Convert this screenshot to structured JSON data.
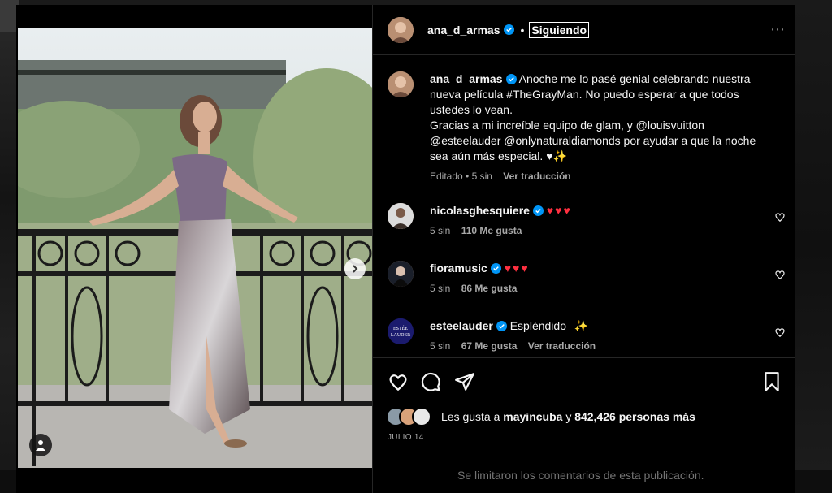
{
  "post": {
    "author": {
      "username": "ana_d_armas",
      "follow_state": "Siguiendo"
    },
    "caption": {
      "text": "Anoche me lo pasé genial celebrando nuestra nueva película #TheGrayMan. No puedo esperar a que todos ustedes lo vean.",
      "text2": "Gracias a mi increíble equipo de glam, y @louisvuitton @esteelauder @onlynaturaldiamonds por ayudar a que la noche sea aún más especial. ♥✨",
      "edited": "Editado • 5 sin",
      "translate": "Ver traducción"
    },
    "comments": [
      {
        "username": "nicolasghesquiere",
        "text": "♥♥♥",
        "time": "5 sin",
        "likes": "110 Me gusta",
        "translate": ""
      },
      {
        "username": "fioramusic",
        "text": "♥♥♥",
        "time": "5 sin",
        "likes": "86 Me gusta",
        "translate": ""
      },
      {
        "username": "esteelauder",
        "text": "Espléndido",
        "emoji": "✨",
        "time": "5 sin",
        "likes": "67 Me gusta",
        "translate": "Ver traducción"
      }
    ],
    "likes": {
      "prefix": "Les gusta a",
      "user": "mayincuba",
      "joiner": "y",
      "count": "842,426 personas más"
    },
    "date": "JULIO 14",
    "comments_notice": "Se limitaron los comentarios de esta publicación."
  },
  "colors": {
    "verified": "#0095f6",
    "heart": "#ff3040",
    "muted": "#a8a8a8"
  },
  "icons": [
    "more-icon",
    "verified-icon",
    "heart-icon",
    "comment-icon",
    "share-icon",
    "bookmark-icon",
    "next-arrow-icon",
    "tag-user-icon"
  ]
}
